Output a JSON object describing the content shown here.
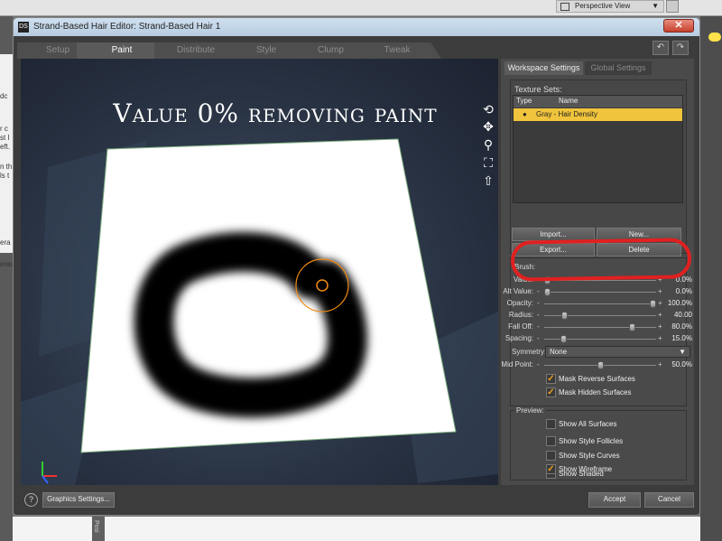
{
  "background": {
    "viewport_menu_label": "Perspective View",
    "left_panel_fragments": [
      "dc",
      "r c",
      "st l",
      "eft.",
      "n th",
      "ls t",
      "era",
      "eras"
    ],
    "bottom_strip_label": "Posi"
  },
  "dialog": {
    "app_icon": "DS",
    "title": "Strand-Based Hair Editor: Strand-Based Hair 1",
    "close_label": "✕",
    "tabs": [
      {
        "label": "Setup",
        "active": false
      },
      {
        "label": "Paint",
        "active": true
      },
      {
        "label": "Distribute",
        "active": false
      },
      {
        "label": "Style",
        "active": false
      },
      {
        "label": "Clump",
        "active": false
      },
      {
        "label": "Tweak",
        "active": false
      }
    ],
    "undo_label": "↶",
    "redo_label": "↷"
  },
  "viewport": {
    "overlay_title": "Value 0% removing paint",
    "tool_icons": [
      "orbit-icon",
      "pan-icon",
      "zoom-icon",
      "frame-icon",
      "reset-icon"
    ],
    "colors": {
      "paint": "#000000",
      "surface": "#ffffff",
      "brush_ring": "#f28a12"
    }
  },
  "panel": {
    "tabs": [
      {
        "label": "Workspace Settings",
        "active": true
      },
      {
        "label": "Global Settings",
        "active": false
      }
    ],
    "texture_sets_label": "Texture Sets:",
    "table_headers": {
      "type": "Type",
      "name": "Name"
    },
    "texture_rows": [
      {
        "type": "●",
        "name": "Gray - Hair Density",
        "selected": true
      }
    ],
    "buttons": {
      "import": "Import...",
      "new": "New...",
      "export": "Export...",
      "delete": "Delete"
    },
    "brush_label": "Brush:",
    "sliders": [
      {
        "label": "Value:",
        "value": "0.0%",
        "level": 0.0
      },
      {
        "label": "Alt Value:",
        "value": "0.0%",
        "level": 0.0
      },
      {
        "label": "Opacity:",
        "value": "100.0%",
        "level": 1.0
      },
      {
        "label": "Radius:",
        "value": "40.00",
        "level": 0.16
      },
      {
        "label": "Fall Off:",
        "value": "80.0%",
        "level": 0.8
      },
      {
        "label": "Spacing:",
        "value": "15.0%",
        "level": 0.15
      }
    ],
    "symmetry_label": "Symmetry:",
    "symmetry_value": "None",
    "midpoint": {
      "label": "Mid Point:",
      "value": "50.0%",
      "level": 0.5
    },
    "mask_options": [
      {
        "label": "Mask Reverse Surfaces",
        "checked": true
      },
      {
        "label": "Mask Hidden Surfaces",
        "checked": true
      }
    ],
    "preview_label": "Preview:",
    "preview_options": [
      {
        "label": "Show All Surfaces",
        "checked": false
      },
      {
        "label": "Show Style Follicles",
        "checked": false
      },
      {
        "label": "Show Style Curves",
        "checked": false
      },
      {
        "label": "Show Shaded",
        "checked": false
      },
      {
        "label": "Show Wireframe",
        "checked": true
      }
    ]
  },
  "footer": {
    "help_label": "?",
    "graphics_settings": "Graphics Settings...",
    "accept": "Accept",
    "cancel": "Cancel"
  }
}
